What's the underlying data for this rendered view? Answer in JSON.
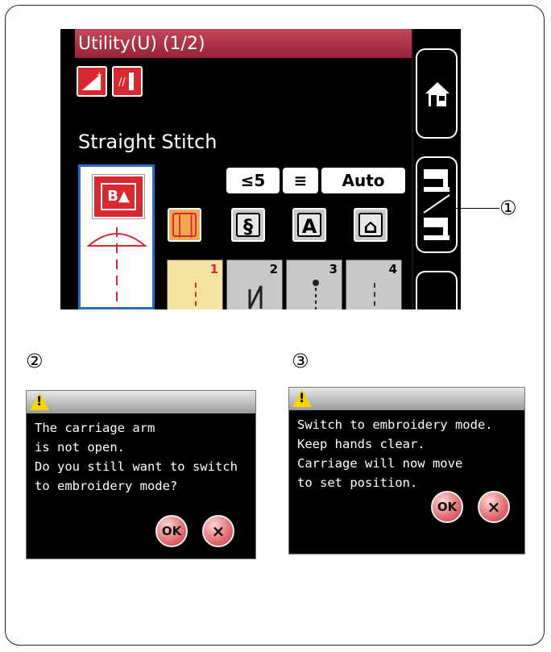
{
  "screen": {
    "title": "Utility(U) (1/2)",
    "stitch_name": "Straight Stitch",
    "preview_button": "B▲",
    "chips": {
      "foot": "≤5",
      "feed": "≡",
      "tension": "Auto"
    },
    "categories": [
      "││",
      "§",
      "A",
      "⌂"
    ],
    "patterns": [
      {
        "num": "1"
      },
      {
        "num": "2"
      },
      {
        "num": "3"
      },
      {
        "num": "4"
      }
    ]
  },
  "callouts": {
    "one": "①",
    "two": "②",
    "three": "③"
  },
  "dialog_a": {
    "lines": [
      "The carriage arm",
      "is not open.",
      "Do you still want to switch",
      "to embroidery mode?"
    ],
    "ok": "OK",
    "cancel": "×"
  },
  "dialog_b": {
    "lines": [
      "Switch to embroidery mode.",
      "Keep hands clear.",
      "Carriage will now move",
      "to set position."
    ],
    "ok": "OK",
    "cancel": "×"
  }
}
